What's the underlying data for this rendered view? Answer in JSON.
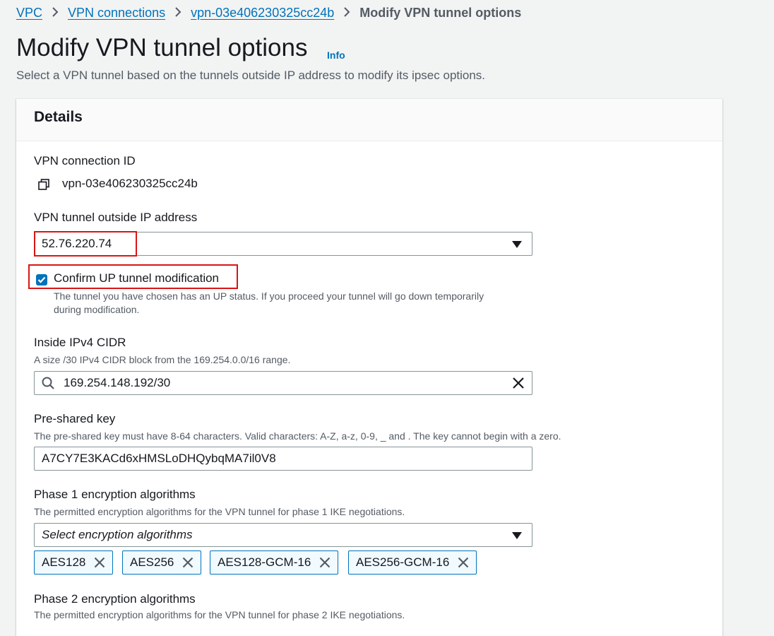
{
  "breadcrumb": {
    "items": [
      "VPC",
      "VPN connections",
      "vpn-03e406230325cc24b"
    ],
    "current": "Modify VPN tunnel options"
  },
  "page": {
    "title": "Modify VPN tunnel options",
    "info": "Info",
    "description": "Select a VPN tunnel based on the tunnels outside IP address to modify its ipsec options."
  },
  "details": {
    "title": "Details",
    "vpn_connection_id_label": "VPN connection ID",
    "vpn_connection_id_value": "vpn-03e406230325cc24b",
    "tunnel_ip_label": "VPN tunnel outside IP address",
    "tunnel_ip_value": "52.76.220.74",
    "confirm_label": "Confirm UP tunnel modification",
    "confirm_checked": true,
    "confirm_desc_line1": "The tunnel you have chosen has an UP status. If you proceed your tunnel will go down temporarily",
    "confirm_desc_line2": "during modification.",
    "cidr_label": "Inside IPv4 CIDR",
    "cidr_desc": "A size /30 IPv4 CIDR block from the 169.254.0.0/16 range.",
    "cidr_value": "169.254.148.192/30",
    "psk_label": "Pre-shared key",
    "psk_desc": "The pre-shared key must have 8-64 characters. Valid characters: A-Z, a-z, 0-9, _ and . The key cannot begin with a zero.",
    "psk_value": "A7CY7E3KACd6xHMSLoDHQybqMA7il0V8",
    "phase1_label": "Phase 1 encryption algorithms",
    "phase1_desc": "The permitted encryption algorithms for the VPN tunnel for phase 1 IKE negotiations.",
    "phase1_placeholder": "Select encryption algorithms",
    "phase1_tokens": [
      "AES128",
      "AES256",
      "AES128-GCM-16",
      "AES256-GCM-16"
    ],
    "phase2_label": "Phase 2 encryption algorithms",
    "phase2_desc": "The permitted encryption algorithms for the VPN tunnel for phase 2 IKE negotiations."
  },
  "colors": {
    "link": "#0073bb",
    "highlight": "#d91515",
    "background": "#f2f3f3"
  }
}
